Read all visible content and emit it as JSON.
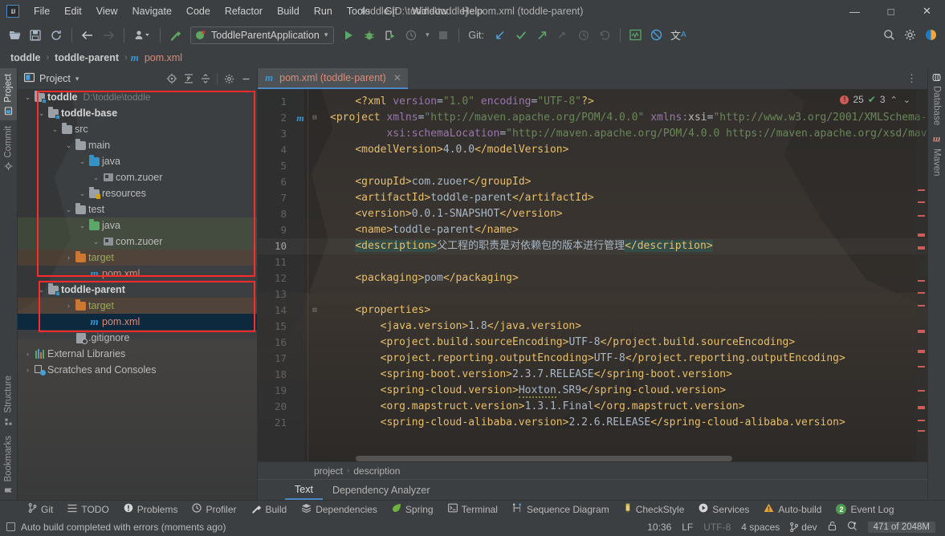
{
  "window": {
    "title": "toddle [D:\\toddle\\toddle] - pom.xml (toddle-parent)",
    "logo": "IJ",
    "minimize": "—",
    "maximize": "□",
    "close": "✕"
  },
  "menubar": [
    {
      "label": "File"
    },
    {
      "label": "Edit"
    },
    {
      "label": "View"
    },
    {
      "label": "Navigate"
    },
    {
      "label": "Code"
    },
    {
      "label": "Refactor"
    },
    {
      "label": "Build"
    },
    {
      "label": "Run"
    },
    {
      "label": "Tools"
    },
    {
      "label": "Git"
    },
    {
      "label": "Window"
    },
    {
      "label": "Help"
    }
  ],
  "toolbar": {
    "open_icon": "📂",
    "save_icon": "💾",
    "sync_icon": "⟳",
    "back_icon": "←",
    "forward_icon": "→",
    "profile_icon": "👤",
    "dropdown_icon": "▾",
    "build_icon": "🔨",
    "run_config": "ToddleParentApplication",
    "run_icon": "▶",
    "debug_icon": "🐞",
    "run_coverage_icon": "▶",
    "profiler_icon": "◷",
    "stop_icon": "■",
    "git_label": "Git:",
    "git_update_icon": "↙",
    "git_commit_icon": "✓",
    "git_push_icon": "↗",
    "git_cherry_icon": "⤳",
    "git_history_icon": "◷",
    "git_revert_icon": "↺",
    "monitor_icon": "▨",
    "block_icon": "⊘",
    "translate_icon": "文A",
    "search_icon": "🔍",
    "settings_icon": "⚙",
    "ide_icon": "◐"
  },
  "navbar": {
    "crumbs": [
      "toddle",
      "toddle-parent"
    ],
    "separator": "›",
    "file": "pom.xml",
    "file_icon": "m"
  },
  "stripes": {
    "left_top": [
      {
        "label": "Project",
        "icon": "▣",
        "active": true
      },
      {
        "label": "Commit",
        "icon": "◈",
        "active": false
      }
    ],
    "left_bottom": [
      {
        "label": "Structure",
        "icon": "▦",
        "active": false
      },
      {
        "label": "Bookmarks",
        "icon": "🔖",
        "active": false
      }
    ],
    "right_top": [
      {
        "label": "Database",
        "icon": "▤",
        "active": false
      },
      {
        "label": "Maven",
        "icon": "m",
        "active": false
      }
    ]
  },
  "project_panel": {
    "title": "Project",
    "dropdown_icon": "▾",
    "panel_icon": "▣",
    "tools": [
      {
        "name": "locate-icon",
        "glyph": "⊕"
      },
      {
        "name": "expand-all-icon",
        "glyph": "⇱"
      },
      {
        "name": "collapse-all-icon",
        "glyph": "⇲"
      },
      {
        "name": "settings-icon",
        "glyph": "⚙"
      },
      {
        "name": "hide-icon",
        "glyph": "—"
      }
    ],
    "tree": [
      {
        "depth": 0,
        "arrow": "⌄",
        "icon": "module",
        "label": "toddle",
        "bold": true,
        "path": "D:\\toddle\\toddle",
        "state": "normal"
      },
      {
        "depth": 1,
        "arrow": "⌄",
        "icon": "module",
        "label": "toddle-base",
        "bold": true,
        "path": "",
        "state": "normal"
      },
      {
        "depth": 2,
        "arrow": "⌄",
        "icon": "folder-gray",
        "label": "src",
        "bold": false,
        "path": "",
        "state": "normal"
      },
      {
        "depth": 3,
        "arrow": "⌄",
        "icon": "folder-gray",
        "label": "main",
        "bold": false,
        "path": "",
        "state": "normal"
      },
      {
        "depth": 4,
        "arrow": "⌄",
        "icon": "folder-blue",
        "label": "java",
        "bold": false,
        "path": "",
        "state": "normal"
      },
      {
        "depth": 5,
        "arrow": "⌄",
        "icon": "package",
        "label": "com.zuoer",
        "bold": false,
        "path": "",
        "state": "normal"
      },
      {
        "depth": 4,
        "arrow": "⌄",
        "icon": "folder-resources",
        "label": "resources",
        "bold": false,
        "path": "",
        "state": "normal"
      },
      {
        "depth": 3,
        "arrow": "⌄",
        "icon": "folder-gray",
        "label": "test",
        "bold": false,
        "path": "",
        "state": "normal"
      },
      {
        "depth": 4,
        "arrow": "⌄",
        "icon": "folder-green",
        "label": "java",
        "bold": false,
        "path": "",
        "state": "green"
      },
      {
        "depth": 5,
        "arrow": "⌄",
        "icon": "package",
        "label": "com.zuoer",
        "bold": false,
        "path": "",
        "state": "green"
      },
      {
        "depth": 3,
        "arrow": "›",
        "icon": "folder-orange",
        "label": "target",
        "bold": false,
        "path": "",
        "state": "brown"
      },
      {
        "depth": 4,
        "arrow": "",
        "icon": "maven",
        "label": "pom.xml",
        "bold": false,
        "path": "",
        "state": "normal"
      },
      {
        "depth": 1,
        "arrow": "⌄",
        "icon": "module",
        "label": "toddle-parent",
        "bold": true,
        "path": "",
        "state": "normal"
      },
      {
        "depth": 3,
        "arrow": "›",
        "icon": "folder-orange",
        "label": "target",
        "bold": false,
        "path": "",
        "state": "brown"
      },
      {
        "depth": 4,
        "arrow": "",
        "icon": "maven",
        "label": "pom.xml",
        "bold": false,
        "path": "",
        "state": "selected"
      },
      {
        "depth": 3,
        "arrow": "",
        "icon": "gitignore",
        "label": ".gitignore",
        "bold": false,
        "path": "",
        "state": "normal"
      },
      {
        "depth": 0,
        "arrow": "›",
        "icon": "libraries",
        "label": "External Libraries",
        "bold": false,
        "path": "",
        "state": "normal"
      },
      {
        "depth": 0,
        "arrow": "›",
        "icon": "scratches",
        "label": "Scratches and Consoles",
        "bold": false,
        "path": "",
        "state": "normal"
      }
    ]
  },
  "editor": {
    "tab": {
      "label": "pom.xml (toddle-parent)",
      "icon": "m",
      "close": "✕"
    },
    "options_icon": "⋮",
    "inspections": {
      "error_count": "25",
      "error_icon": "!",
      "warn_count": "3",
      "warn_icon": "✔",
      "up": "⌃",
      "down": "⌄"
    },
    "lines": [
      {
        "n": "1",
        "gutter": "",
        "fold": "",
        "indent": 4,
        "segments": [
          {
            "t": "<?xml ",
            "c": "pi"
          },
          {
            "t": "version",
            "c": "attr"
          },
          {
            "t": "=",
            "c": "val"
          },
          {
            "t": "\"1.0\"",
            "c": "str"
          },
          {
            "t": " ",
            "c": "val"
          },
          {
            "t": "encoding",
            "c": "attr"
          },
          {
            "t": "=",
            "c": "val"
          },
          {
            "t": "\"UTF-8\"",
            "c": "str"
          },
          {
            "t": "?>",
            "c": "pi"
          }
        ]
      },
      {
        "n": "2",
        "gutter": "m",
        "fold": "⊟",
        "indent": 0,
        "segments": [
          {
            "t": "<project ",
            "c": "tag"
          },
          {
            "t": "xmlns",
            "c": "attr"
          },
          {
            "t": "=",
            "c": "val"
          },
          {
            "t": "\"http://maven.apache.org/POM/4.0.0\"",
            "c": "str"
          },
          {
            "t": " ",
            "c": "val"
          },
          {
            "t": "xmlns:",
            "c": "attr"
          },
          {
            "t": "xsi",
            "c": "attr2"
          },
          {
            "t": "=",
            "c": "val"
          },
          {
            "t": "\"http://www.w3.org/2001/XMLSchema-i",
            "c": "str"
          }
        ]
      },
      {
        "n": "3",
        "gutter": "",
        "fold": "",
        "indent": 9,
        "segments": [
          {
            "t": "xsi:",
            "c": "attr"
          },
          {
            "t": "schemaLocation",
            "c": "attr"
          },
          {
            "t": "=",
            "c": "val"
          },
          {
            "t": "\"http://maven.apache.org/POM/4.0.0 https://maven.apache.org/xsd/mav",
            "c": "str"
          }
        ]
      },
      {
        "n": "4",
        "gutter": "",
        "fold": "",
        "indent": 4,
        "segments": [
          {
            "t": "<modelVersion>",
            "c": "tag"
          },
          {
            "t": "4.0.0",
            "c": "val"
          },
          {
            "t": "</modelVersion>",
            "c": "tag"
          }
        ]
      },
      {
        "n": "5",
        "gutter": "",
        "fold": "",
        "indent": 0,
        "segments": []
      },
      {
        "n": "6",
        "gutter": "",
        "fold": "",
        "indent": 4,
        "segments": [
          {
            "t": "<groupId>",
            "c": "tag"
          },
          {
            "t": "com.zuoer",
            "c": "val"
          },
          {
            "t": "</groupId>",
            "c": "tag"
          }
        ]
      },
      {
        "n": "7",
        "gutter": "",
        "fold": "",
        "indent": 4,
        "segments": [
          {
            "t": "<artifactId>",
            "c": "tag"
          },
          {
            "t": "toddle-parent",
            "c": "val"
          },
          {
            "t": "</artifactId>",
            "c": "tag"
          }
        ]
      },
      {
        "n": "8",
        "gutter": "",
        "fold": "",
        "indent": 4,
        "segments": [
          {
            "t": "<version>",
            "c": "tag"
          },
          {
            "t": "0.0.1-SNAPSHOT",
            "c": "val"
          },
          {
            "t": "</version>",
            "c": "tag"
          }
        ]
      },
      {
        "n": "9",
        "gutter": "",
        "fold": "",
        "indent": 4,
        "segments": [
          {
            "t": "<name>",
            "c": "tag"
          },
          {
            "t": "toddle-parent",
            "c": "val"
          },
          {
            "t": "</name>",
            "c": "tag"
          }
        ]
      },
      {
        "n": "10",
        "gutter": "",
        "fold": "",
        "indent": 4,
        "current": true,
        "segments": [
          {
            "t": "<description>",
            "c": "tag hl"
          },
          {
            "t": "父工程的职责是对依赖包的版本进行管理",
            "c": "val"
          },
          {
            "t": "</description>",
            "c": "tag hl"
          }
        ]
      },
      {
        "n": "11",
        "gutter": "",
        "fold": "",
        "indent": 0,
        "segments": []
      },
      {
        "n": "12",
        "gutter": "",
        "fold": "",
        "indent": 4,
        "segments": [
          {
            "t": "<packaging>",
            "c": "tag"
          },
          {
            "t": "pom",
            "c": "val"
          },
          {
            "t": "</packaging>",
            "c": "tag"
          }
        ]
      },
      {
        "n": "13",
        "gutter": "",
        "fold": "",
        "indent": 0,
        "segments": []
      },
      {
        "n": "14",
        "gutter": "",
        "fold": "⊟",
        "indent": 4,
        "segments": [
          {
            "t": "<properties>",
            "c": "tag"
          }
        ]
      },
      {
        "n": "15",
        "gutter": "",
        "fold": "",
        "indent": 8,
        "segments": [
          {
            "t": "<java.version>",
            "c": "tag"
          },
          {
            "t": "1.8",
            "c": "val"
          },
          {
            "t": "</java.version>",
            "c": "tag"
          }
        ]
      },
      {
        "n": "16",
        "gutter": "",
        "fold": "",
        "indent": 8,
        "segments": [
          {
            "t": "<project.build.sourceEncoding>",
            "c": "tag"
          },
          {
            "t": "UTF-8",
            "c": "val"
          },
          {
            "t": "</project.build.sourceEncoding>",
            "c": "tag"
          }
        ]
      },
      {
        "n": "17",
        "gutter": "",
        "fold": "",
        "indent": 8,
        "segments": [
          {
            "t": "<project.reporting.outputEncoding>",
            "c": "tag"
          },
          {
            "t": "UTF-8",
            "c": "val"
          },
          {
            "t": "</project.reporting.outputEncoding>",
            "c": "tag"
          }
        ]
      },
      {
        "n": "18",
        "gutter": "",
        "fold": "",
        "indent": 8,
        "segments": [
          {
            "t": "<spring-boot.version>",
            "c": "tag"
          },
          {
            "t": "2.3.7.RELEASE",
            "c": "val"
          },
          {
            "t": "</spring-boot.version>",
            "c": "tag"
          }
        ]
      },
      {
        "n": "19",
        "gutter": "",
        "fold": "",
        "indent": 8,
        "segments": [
          {
            "t": "<spring-cloud.version>",
            "c": "tag"
          },
          {
            "t": "Hoxton",
            "c": "val wavy"
          },
          {
            "t": ".SR9",
            "c": "val"
          },
          {
            "t": "</spring-cloud.version>",
            "c": "tag"
          }
        ]
      },
      {
        "n": "20",
        "gutter": "",
        "fold": "",
        "indent": 8,
        "segments": [
          {
            "t": "<org.mapstruct.version>",
            "c": "tag"
          },
          {
            "t": "1.3.1.Final",
            "c": "val"
          },
          {
            "t": "</org.mapstruct.version>",
            "c": "tag"
          }
        ]
      },
      {
        "n": "21",
        "gutter": "",
        "fold": "",
        "indent": 8,
        "segments": [
          {
            "t": "<spring-cloud-alibaba.version>",
            "c": "tag"
          },
          {
            "t": "2.2.6.RELEASE",
            "c": "val"
          },
          {
            "t": "</spring-cloud-alibaba.version>",
            "c": "tag"
          }
        ]
      }
    ],
    "breadcrumbs": [
      {
        "label": "project"
      },
      {
        "label": "description"
      }
    ],
    "bottom_tabs": [
      {
        "label": "Text",
        "active": true
      },
      {
        "label": "Dependency Analyzer",
        "active": false
      }
    ]
  },
  "tool_strip": [
    {
      "label": "Git",
      "icon": "⑂"
    },
    {
      "label": "TODO",
      "icon": "☰"
    },
    {
      "label": "Problems",
      "icon": "❶"
    },
    {
      "label": "Profiler",
      "icon": "◔"
    },
    {
      "label": "Build",
      "icon": "🔨"
    },
    {
      "label": "Dependencies",
      "icon": "❖"
    },
    {
      "label": "Spring",
      "icon": "🌿"
    },
    {
      "label": "Terminal",
      "icon": "▣"
    },
    {
      "label": "Sequence Diagram",
      "icon": "⇵"
    },
    {
      "label": "CheckStyle",
      "icon": "✎"
    },
    {
      "label": "Services",
      "icon": "▶"
    },
    {
      "label": "Auto-build",
      "icon": "⚠"
    },
    {
      "label": "Event Log",
      "icon": "2",
      "badge": true
    }
  ],
  "statusbar": {
    "message": "Auto build completed with errors (moments ago)",
    "message_icon": "▢",
    "position": "10:36",
    "line_sep": "LF",
    "encoding": "UTF-8",
    "indent": "4 spaces",
    "branch": "dev",
    "branch_icon": "⑂",
    "lock_icon": "🔓",
    "inspection_icon": "◕",
    "memory": "471 of 2048M"
  },
  "colors": {
    "accent_blue": "#4a88c7",
    "error_red": "#cf5b56",
    "highlight_red": "#ff2a2a",
    "selection_blue": "#0d293e",
    "string_green": "#6a8759",
    "tag_yellow": "#e8bf6a"
  }
}
